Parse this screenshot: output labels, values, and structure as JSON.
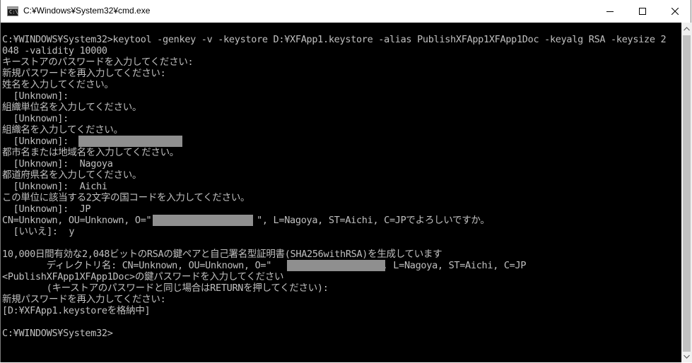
{
  "window": {
    "title": "C:¥Windows¥System32¥cmd.exe",
    "icon_text": "C:\\"
  },
  "controls": {
    "minimize": "minimize-icon",
    "maximize": "maximize-icon",
    "close": "close-icon"
  },
  "terminal": {
    "lines": [
      "",
      "C:¥WINDOWS¥System32>keytool -genkey -v -keystore D:¥XFApp1.keystore -alias PublishXFApp1XFApp1Doc -keyalg RSA -keysize 2",
      "048 -validity 10000",
      "キーストアのパスワードを入力してください:",
      "新規パスワードを再入力してください:",
      "姓名を入力してください。",
      "  [Unknown]:",
      "組織単位名を入力してください。",
      "  [Unknown]:",
      "組織名を入力してください。",
      "  [Unknown]:",
      "都市名または地域名を入力してください。",
      "  [Unknown]:  Nagoya",
      "都道府県名を入力してください。",
      "  [Unknown]:  Aichi",
      "この単位に該当する2文字の国コードを入力してください。",
      "  [Unknown]:  JP",
      "CN=Unknown, OU=Unknown, O=\"                   \", L=Nagoya, ST=Aichi, C=JPでよろしいですか。",
      "  [いいえ]:  y",
      "",
      "10,000日間有効な2,048ビットのRSAの鍵ペアと自己署名型証明書(SHA256withRSA)を生成しています",
      "        ディレクトリ名: CN=Unknown, OU=Unknown, O=\"                   \", L=Nagoya, ST=Aichi, C=JP",
      "<PublishXFApp1XFApp1Doc>の鍵パスワードを入力してください",
      "        (キーストアのパスワードと同じ場合はRETURNを押してください):",
      "新規パスワードを再入力してください:",
      "[D:¥XFApp1.keystoreを格納中]",
      "",
      "C:¥WINDOWS¥System32>"
    ]
  },
  "scrollbar": {
    "up": "scroll-up-arrow-icon",
    "down": "scroll-down-arrow-icon"
  }
}
